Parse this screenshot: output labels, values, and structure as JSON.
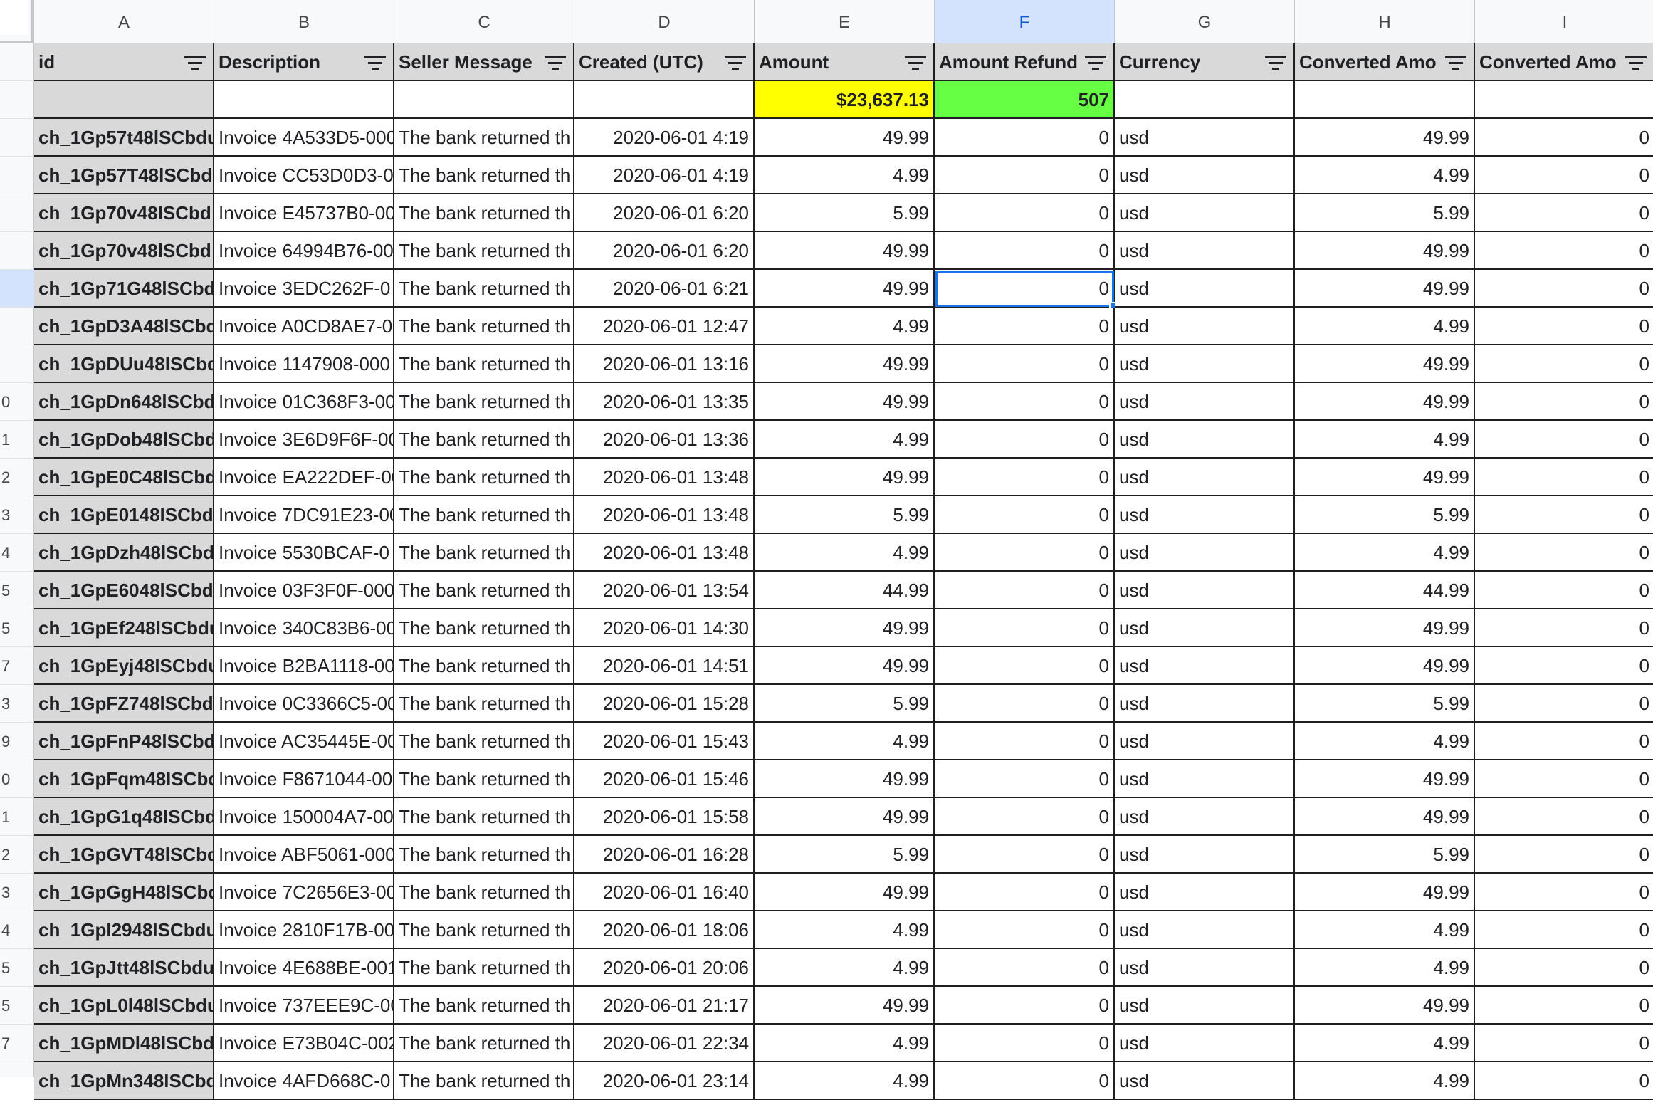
{
  "columns": [
    "A",
    "B",
    "C",
    "D",
    "E",
    "F",
    "G",
    "H",
    "I"
  ],
  "active_column": "F",
  "headers": [
    "id",
    "Description",
    "Seller Message",
    "Created (UTC)",
    "Amount",
    "Amount Refund",
    "Currency",
    "Converted Amo",
    "Converted Amo"
  ],
  "summary": {
    "amount_total": "$23,637.13",
    "refund_total": "507"
  },
  "row_numbers": [
    "",
    "",
    "",
    "",
    "",
    "",
    "",
    "",
    "",
    "0",
    "1",
    "2",
    "3",
    "4",
    "5",
    "5",
    "7",
    "3",
    "9",
    "0",
    "1",
    "2",
    "3",
    "4",
    "5",
    "5",
    "7"
  ],
  "rows": [
    {
      "id": "ch_1Gp57t48lSCbdu",
      "desc": "Invoice 4A533D5-000",
      "msg": "The bank returned th",
      "created": "2020-06-01 4:19",
      "amount": "49.99",
      "refund": "0",
      "currency": "usd",
      "conv": "49.99",
      "conv2": "0"
    },
    {
      "id": "ch_1Gp57T48lSCbd",
      "desc": "Invoice CC53D0D3-0",
      "msg": "The bank returned th",
      "created": "2020-06-01 4:19",
      "amount": "4.99",
      "refund": "0",
      "currency": "usd",
      "conv": "4.99",
      "conv2": "0"
    },
    {
      "id": "ch_1Gp70v48lSCbd",
      "desc": "Invoice E45737B0-00",
      "msg": "The bank returned th",
      "created": "2020-06-01 6:20",
      "amount": "5.99",
      "refund": "0",
      "currency": "usd",
      "conv": "5.99",
      "conv2": "0"
    },
    {
      "id": "ch_1Gp70v48lSCbd",
      "desc": "Invoice 64994B76-00",
      "msg": "The bank returned th",
      "created": "2020-06-01 6:20",
      "amount": "49.99",
      "refund": "0",
      "currency": "usd",
      "conv": "49.99",
      "conv2": "0"
    },
    {
      "id": "ch_1Gp71G48lSCbd",
      "desc": "Invoice 3EDC262F-0",
      "msg": "The bank returned th",
      "created": "2020-06-01 6:21",
      "amount": "49.99",
      "refund": "0",
      "currency": "usd",
      "conv": "49.99",
      "conv2": "0"
    },
    {
      "id": "ch_1GpD3A48lSCbd",
      "desc": "Invoice A0CD8AE7-0",
      "msg": "The bank returned th",
      "created": "2020-06-01 12:47",
      "amount": "4.99",
      "refund": "0",
      "currency": "usd",
      "conv": "4.99",
      "conv2": "0"
    },
    {
      "id": "ch_1GpDUu48lSCbd",
      "desc": "Invoice 1147908-000",
      "msg": "The bank returned th",
      "created": "2020-06-01 13:16",
      "amount": "49.99",
      "refund": "0",
      "currency": "usd",
      "conv": "49.99",
      "conv2": "0"
    },
    {
      "id": "ch_1GpDn648lSCbd",
      "desc": "Invoice 01C368F3-00",
      "msg": "The bank returned th",
      "created": "2020-06-01 13:35",
      "amount": "49.99",
      "refund": "0",
      "currency": "usd",
      "conv": "49.99",
      "conv2": "0"
    },
    {
      "id": "ch_1GpDob48lSCbd",
      "desc": "Invoice 3E6D9F6F-00",
      "msg": "The bank returned th",
      "created": "2020-06-01 13:36",
      "amount": "4.99",
      "refund": "0",
      "currency": "usd",
      "conv": "4.99",
      "conv2": "0"
    },
    {
      "id": "ch_1GpE0C48lSCbd",
      "desc": "Invoice EA222DEF-00",
      "msg": "The bank returned th",
      "created": "2020-06-01 13:48",
      "amount": "49.99",
      "refund": "0",
      "currency": "usd",
      "conv": "49.99",
      "conv2": "0"
    },
    {
      "id": "ch_1GpE0148lSCbd",
      "desc": "Invoice 7DC91E23-00",
      "msg": "The bank returned th",
      "created": "2020-06-01 13:48",
      "amount": "5.99",
      "refund": "0",
      "currency": "usd",
      "conv": "5.99",
      "conv2": "0"
    },
    {
      "id": "ch_1GpDzh48lSCbd",
      "desc": "Invoice 5530BCAF-0",
      "msg": "The bank returned th",
      "created": "2020-06-01 13:48",
      "amount": "4.99",
      "refund": "0",
      "currency": "usd",
      "conv": "4.99",
      "conv2": "0"
    },
    {
      "id": "ch_1GpE6048lSCbd",
      "desc": "Invoice 03F3F0F-000",
      "msg": "The bank returned th",
      "created": "2020-06-01 13:54",
      "amount": "44.99",
      "refund": "0",
      "currency": "usd",
      "conv": "44.99",
      "conv2": "0"
    },
    {
      "id": "ch_1GpEf248lSCbdu",
      "desc": "Invoice 340C83B6-00",
      "msg": "The bank returned th",
      "created": "2020-06-01 14:30",
      "amount": "49.99",
      "refund": "0",
      "currency": "usd",
      "conv": "49.99",
      "conv2": "0"
    },
    {
      "id": "ch_1GpEyj48lSCbdu",
      "desc": "Invoice B2BA1118-00",
      "msg": "The bank returned th",
      "created": "2020-06-01 14:51",
      "amount": "49.99",
      "refund": "0",
      "currency": "usd",
      "conv": "49.99",
      "conv2": "0"
    },
    {
      "id": "ch_1GpFZ748lSCbd",
      "desc": "Invoice 0C3366C5-00",
      "msg": "The bank returned th",
      "created": "2020-06-01 15:28",
      "amount": "5.99",
      "refund": "0",
      "currency": "usd",
      "conv": "5.99",
      "conv2": "0"
    },
    {
      "id": "ch_1GpFnP48lSCbd",
      "desc": "Invoice AC35445E-00",
      "msg": "The bank returned th",
      "created": "2020-06-01 15:43",
      "amount": "4.99",
      "refund": "0",
      "currency": "usd",
      "conv": "4.99",
      "conv2": "0"
    },
    {
      "id": "ch_1GpFqm48lSCbd",
      "desc": "Invoice F8671044-00",
      "msg": "The bank returned th",
      "created": "2020-06-01 15:46",
      "amount": "49.99",
      "refund": "0",
      "currency": "usd",
      "conv": "49.99",
      "conv2": "0"
    },
    {
      "id": "ch_1GpG1q48lSCbd",
      "desc": "Invoice 150004A7-00",
      "msg": "The bank returned th",
      "created": "2020-06-01 15:58",
      "amount": "49.99",
      "refund": "0",
      "currency": "usd",
      "conv": "49.99",
      "conv2": "0"
    },
    {
      "id": "ch_1GpGVT48lSCbd",
      "desc": "Invoice ABF5061-000",
      "msg": "The bank returned th",
      "created": "2020-06-01 16:28",
      "amount": "5.99",
      "refund": "0",
      "currency": "usd",
      "conv": "5.99",
      "conv2": "0"
    },
    {
      "id": "ch_1GpGgH48lSCbd",
      "desc": "Invoice 7C2656E3-00",
      "msg": "The bank returned th",
      "created": "2020-06-01 16:40",
      "amount": "49.99",
      "refund": "0",
      "currency": "usd",
      "conv": "49.99",
      "conv2": "0"
    },
    {
      "id": "ch_1GpI2948lSCbdu",
      "desc": "Invoice 2810F17B-00",
      "msg": "The bank returned th",
      "created": "2020-06-01 18:06",
      "amount": "4.99",
      "refund": "0",
      "currency": "usd",
      "conv": "4.99",
      "conv2": "0"
    },
    {
      "id": "ch_1GpJtt48lSCbdu",
      "desc": "Invoice 4E688BE-001",
      "msg": "The bank returned th",
      "created": "2020-06-01 20:06",
      "amount": "4.99",
      "refund": "0",
      "currency": "usd",
      "conv": "4.99",
      "conv2": "0"
    },
    {
      "id": "ch_1GpL0l48lSCbdu",
      "desc": "Invoice 737EEE9C-00",
      "msg": "The bank returned th",
      "created": "2020-06-01 21:17",
      "amount": "49.99",
      "refund": "0",
      "currency": "usd",
      "conv": "49.99",
      "conv2": "0"
    },
    {
      "id": "ch_1GpMDl48lSCbd",
      "desc": "Invoice E73B04C-002",
      "msg": "The bank returned th",
      "created": "2020-06-01 22:34",
      "amount": "4.99",
      "refund": "0",
      "currency": "usd",
      "conv": "4.99",
      "conv2": "0"
    },
    {
      "id": "ch_1GpMn348lSCbd",
      "desc": "Invoice 4AFD668C-0",
      "msg": "The bank returned th",
      "created": "2020-06-01 23:14",
      "amount": "4.99",
      "refund": "0",
      "currency": "usd",
      "conv": "4.99",
      "conv2": "0"
    }
  ],
  "selected_cell": {
    "row": 4,
    "col": "refund"
  }
}
